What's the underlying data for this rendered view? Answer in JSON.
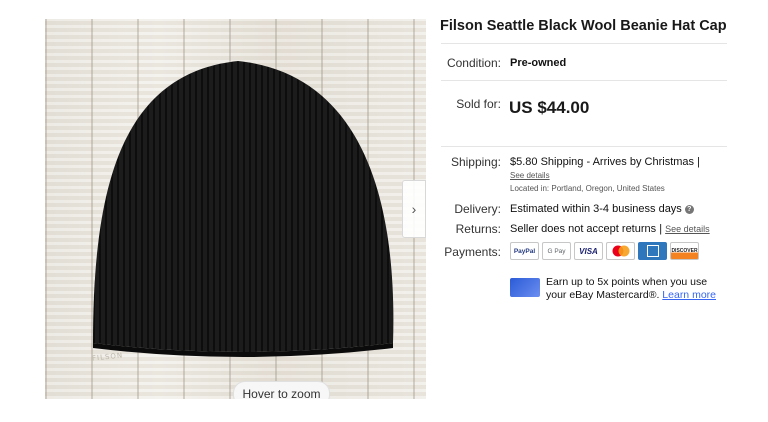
{
  "title": "Filson Seattle Black Wool Beanie Hat Cap",
  "gallery": {
    "hover_label": "Hover to zoom",
    "next_icon": "chevron-right",
    "brand_tag": "FILSON"
  },
  "condition": {
    "label": "Condition:",
    "value": "Pre-owned"
  },
  "sold": {
    "label": "Sold for:",
    "value": "US $44.00"
  },
  "shipping": {
    "label": "Shipping:",
    "value": "$5.80 Shipping - Arrives by Christmas |",
    "details_link": "See details",
    "location": "Located in:  Portland, Oregon, United States"
  },
  "delivery": {
    "label": "Delivery:",
    "value": "Estimated within 3-4 business days"
  },
  "returns": {
    "label": "Returns:",
    "value": "Seller does not accept returns |",
    "details_link": "See details"
  },
  "payments": {
    "label": "Payments:",
    "methods": [
      "PayPal",
      "G Pay",
      "VISA",
      "Mastercard",
      "Amex",
      "DISCOVER"
    ]
  },
  "promo": {
    "line1": "Earn up to 5x points when you use",
    "line2": "your eBay Mastercard®.",
    "link": "Learn more"
  },
  "colors": {
    "link": "#3665f3",
    "hat": "#1a1a1a",
    "divider": "#e5e5e5"
  }
}
